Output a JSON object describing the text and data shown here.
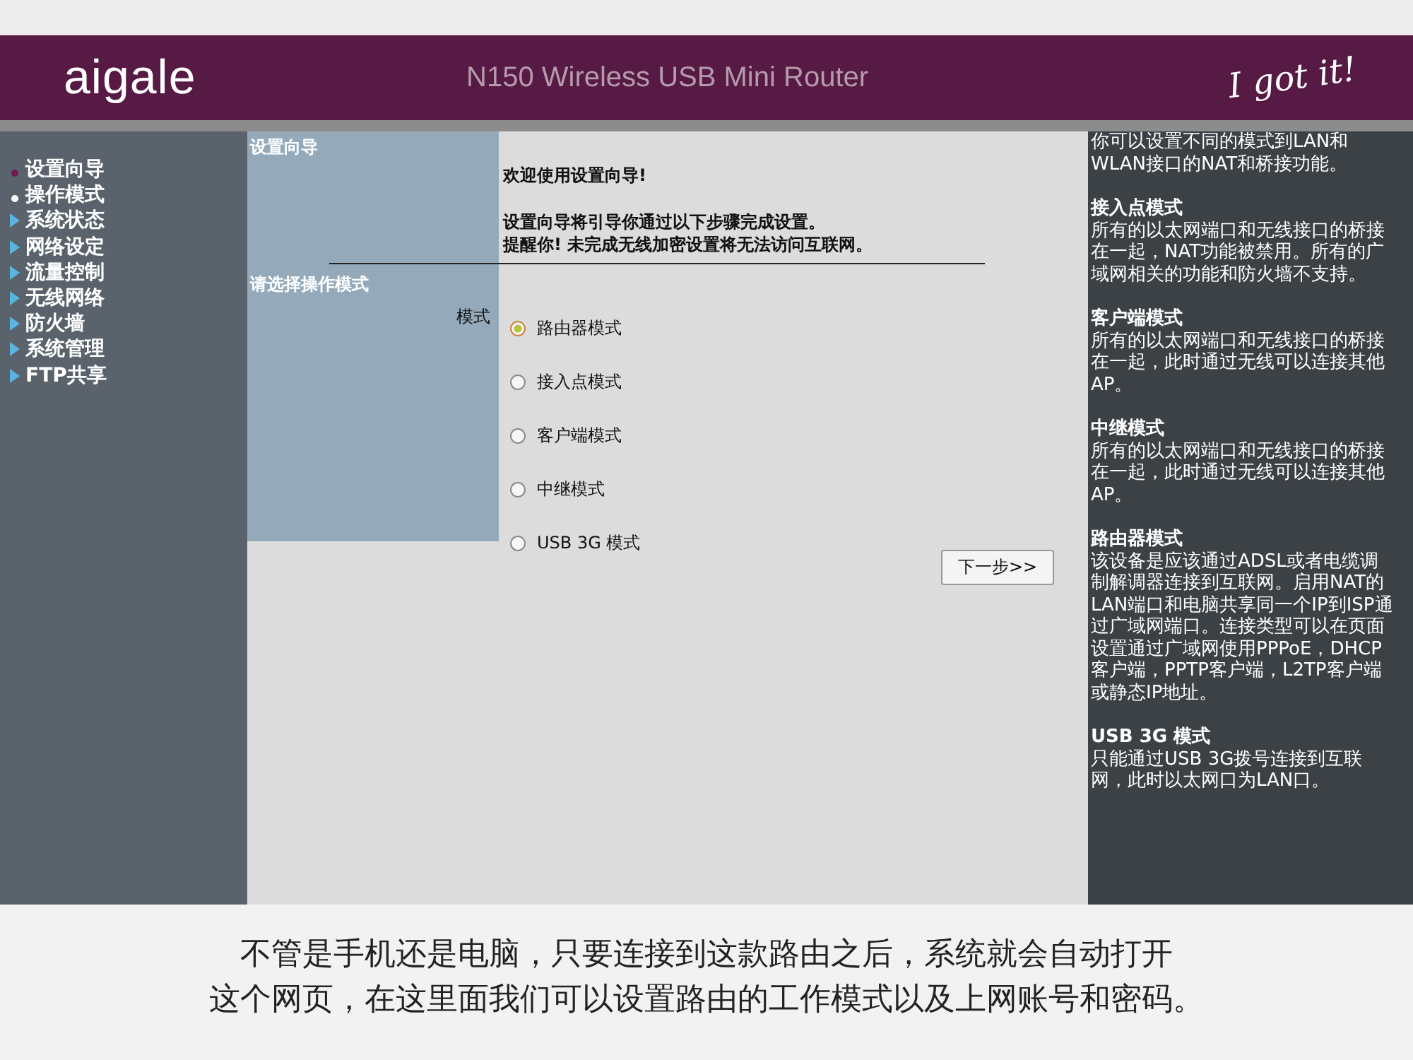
{
  "header": {
    "logo": "aigale",
    "title": "N150 Wireless USB Mini Router",
    "slogan": "I got it!"
  },
  "sidebar": {
    "items": [
      {
        "label": "设置向导",
        "kind": "bullet",
        "selected": true
      },
      {
        "label": "操作模式",
        "kind": "bullet",
        "selected": false
      },
      {
        "label": "系统状态",
        "kind": "arrow",
        "selected": false
      },
      {
        "label": "网络设定",
        "kind": "arrow",
        "selected": false
      },
      {
        "label": "流量控制",
        "kind": "arrow",
        "selected": false
      },
      {
        "label": "无线网络",
        "kind": "arrow",
        "selected": false
      },
      {
        "label": "防火墙",
        "kind": "arrow",
        "selected": false
      },
      {
        "label": "系统管理",
        "kind": "arrow",
        "selected": false
      },
      {
        "label": "FTP共享",
        "kind": "arrow",
        "selected": false
      }
    ]
  },
  "wizard": {
    "section_title": "设置向导",
    "welcome": "欢迎使用设置向导!",
    "intro_lines": [
      "设置向导将引导你通过以下步骤完成设置。",
      "提醒你! 未完成无线加密设置将无法访问互联网。"
    ],
    "mode_section_title": "请选择操作模式",
    "mode_label": "模式",
    "modes": [
      {
        "label": "路由器模式",
        "selected": true
      },
      {
        "label": "接入点模式",
        "selected": false
      },
      {
        "label": "客户端模式",
        "selected": false
      },
      {
        "label": "中继模式",
        "selected": false
      },
      {
        "label": "USB 3G 模式",
        "selected": false
      }
    ],
    "next_button": "下一步>>"
  },
  "help": {
    "intro": "你可以设置不同的模式到LAN和WLAN接口的NAT和桥接功能。",
    "sections": [
      {
        "title": "接入点模式",
        "text": "所有的以太网端口和无线接口的桥接在一起，NAT功能被禁用。所有的广域网相关的功能和防火墙不支持。"
      },
      {
        "title": "客户端模式",
        "text": "所有的以太网端口和无线接口的桥接在一起，此时通过无线可以连接其他AP。"
      },
      {
        "title": "中继模式",
        "text": "所有的以太网端口和无线接口的桥接在一起，此时通过无线可以连接其他AP。"
      },
      {
        "title": "路由器模式",
        "text": "该设备是应该通过ADSL或者电缆调制解调器连接到互联网。启用NAT的LAN端口和电脑共享同一个IP到ISP通过广域网端口。连接类型可以在页面设置通过广域网使用PPPoE，DHCP客户端，PPTP客户端，L2TP客户端或静态IP地址。"
      },
      {
        "title": "USB 3G 模式",
        "text": "只能通过USB 3G拨号连接到互联网，此时以太网口为LAN口。"
      }
    ]
  },
  "caption": {
    "lines": [
      "不管是手机还是电脑，只要连接到这款路由之后，系统就会自动打开",
      "这个网页，在这里面我们可以设置路由的工作模式以及上网账号和密码。"
    ]
  }
}
